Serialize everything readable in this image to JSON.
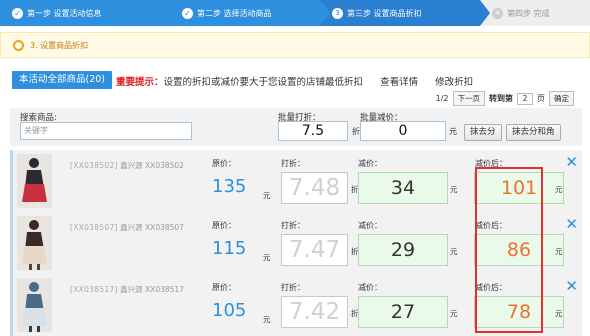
{
  "steps": [
    {
      "label": "第一步 设置活动信息",
      "state": "done"
    },
    {
      "label": "第二步 选择活动商品",
      "state": "done"
    },
    {
      "label": "第三步 设置商品折扣",
      "number": "3",
      "state": "current"
    },
    {
      "label": "第四步 完成",
      "number": "4",
      "state": "todo"
    }
  ],
  "notice": "3. 设置商品折扣",
  "tab_label": "本活动全部商品(20)",
  "tip": {
    "title": "重要提示：",
    "text": "设置的折扣或减价要大于您设置的店铺最低折扣",
    "link1": "查看详情",
    "link2": "修改折扣"
  },
  "pager": {
    "current": "1/2",
    "next": "下一页",
    "goto_label": "转到第",
    "page_value": "2",
    "page_unit": "页",
    "confirm": "确定"
  },
  "batch": {
    "search_label": "搜索商品:",
    "search_placeholder": "关键字",
    "discount_label": "批量打折：",
    "discount_value": "7.5",
    "discount_unit": "折",
    "reduce_label": "批量减价：",
    "reduce_value": "0",
    "reduce_unit": "元",
    "btn_round": "抹去分",
    "btn_round2": "抹去分和角"
  },
  "row_labels": {
    "orig": "原价：",
    "disc": "打折：",
    "reduce": "减价：",
    "after": "减价后：",
    "yuan": "元",
    "zhe": "折"
  },
  "products": [
    {
      "sku": "[XX038502]",
      "name": "鑫兴源 XX038502",
      "price": "135",
      "discount": "7.48",
      "reduce": "34",
      "after": "101",
      "colors": [
        "#2a2a30",
        "#c83040",
        "#f0e8e4"
      ]
    },
    {
      "sku": "[XX038507]",
      "name": "鑫兴源 XX038507",
      "price": "115",
      "discount": "7.47",
      "reduce": "29",
      "after": "86",
      "colors": [
        "#3a2a28",
        "#e8d8c8",
        "#5a4038"
      ]
    },
    {
      "sku": "[XX038517]",
      "name": "鑫兴源 XX038517",
      "price": "105",
      "discount": "7.42",
      "reduce": "27",
      "after": "78",
      "colors": [
        "#4a6a8a",
        "#d8e0e8",
        "#2a3a50"
      ]
    }
  ],
  "accent": "#2e8fde",
  "highlight_color": "#e03030"
}
